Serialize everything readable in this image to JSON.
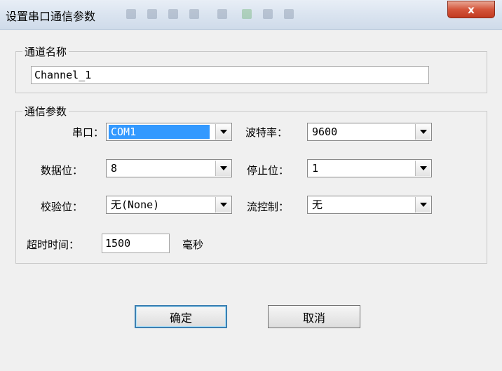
{
  "window": {
    "title": "设置串口通信参数",
    "close_label": "x"
  },
  "channel_group": {
    "label": "通道名称",
    "name_value": "Channel_1"
  },
  "comm_group": {
    "label": "通信参数",
    "port_label": "串口：",
    "port_value": "COM1",
    "baud_label": "波特率：",
    "baud_value": "9600",
    "databits_label": "数据位：",
    "databits_value": "8",
    "stopbits_label": "停止位：",
    "stopbits_value": "1",
    "parity_label": "校验位：",
    "parity_value": "无(None)",
    "flow_label": "流控制：",
    "flow_value": "无",
    "timeout_label": "超时时间：",
    "timeout_value": "1500",
    "timeout_unit": "毫秒"
  },
  "buttons": {
    "ok_label": "确定",
    "cancel_label": "取消"
  },
  "colors": {
    "selection": "#3399ff",
    "close_button": "#d4553b",
    "dialog_background": "#f0f0f0"
  }
}
